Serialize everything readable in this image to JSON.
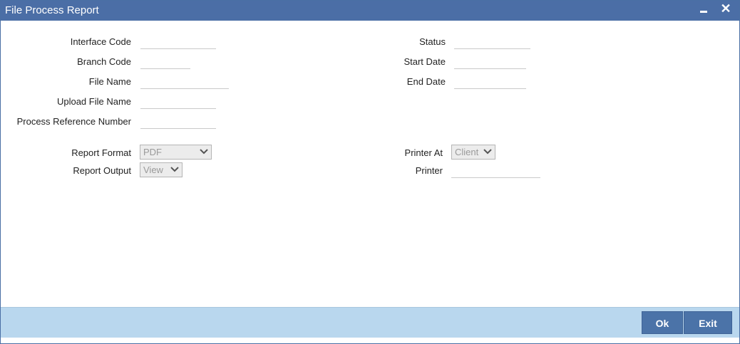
{
  "window": {
    "title": "File Process Report",
    "minimize_icon": "minimize-icon",
    "close_icon": "close-icon",
    "close_glyph": "✕"
  },
  "form": {
    "interface_code": {
      "label": "Interface Code",
      "value": ""
    },
    "branch_code": {
      "label": "Branch Code",
      "value": ""
    },
    "file_name": {
      "label": "File Name",
      "value": ""
    },
    "upload_file_name": {
      "label": "Upload File Name",
      "value": ""
    },
    "process_reference_number": {
      "label": "Process Reference Number",
      "value": ""
    },
    "status": {
      "label": "Status",
      "value": ""
    },
    "start_date": {
      "label": "Start Date",
      "value": ""
    },
    "end_date": {
      "label": "End Date",
      "value": ""
    },
    "report_format": {
      "label": "Report Format",
      "selected": "PDF"
    },
    "report_output": {
      "label": "Report Output",
      "selected": "View"
    },
    "printer_at": {
      "label": "Printer At",
      "selected": "Client"
    },
    "printer": {
      "label": "Printer",
      "value": ""
    }
  },
  "footer": {
    "ok_label": "Ok",
    "exit_label": "Exit"
  },
  "colors": {
    "titlebar": "#4b6ea6",
    "footer": "#b9d7ee",
    "button": "#4b73a8"
  }
}
